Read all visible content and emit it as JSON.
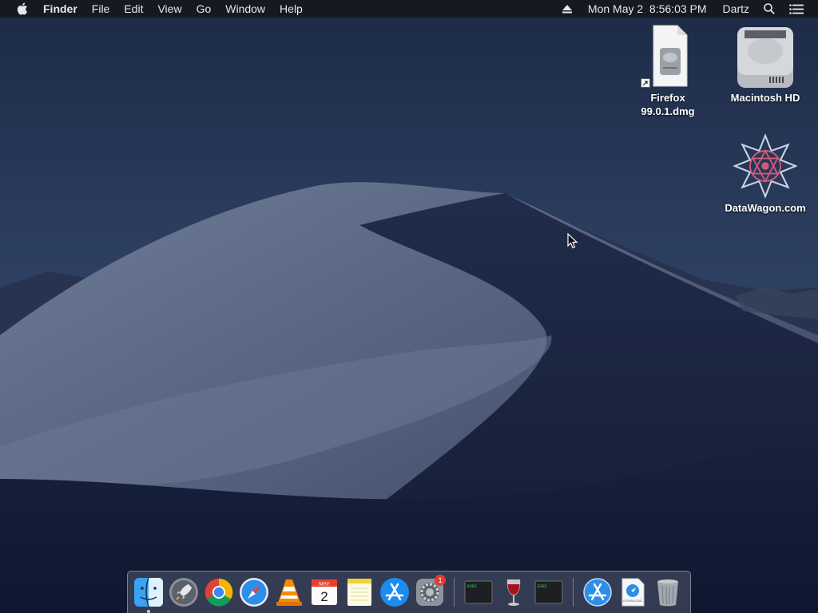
{
  "menubar": {
    "apple_icon": "apple-logo-icon",
    "app_name": "Finder",
    "menus": [
      "File",
      "Edit",
      "View",
      "Go",
      "Window",
      "Help"
    ],
    "eject_icon": "eject-icon",
    "clock": "Mon May 2  8:56:03 PM",
    "user": "Dartz",
    "search_icon": "spotlight-search-icon",
    "notification_icon": "notification-center-icon"
  },
  "desktop": {
    "icons": [
      {
        "label": "Firefox\n99.0.1.dmg",
        "icon": "disk-image-file-icon"
      },
      {
        "label": "Macintosh HD",
        "icon": "hard-drive-icon"
      },
      {
        "label": "DataWagon.com",
        "icon": "datawagon-logo-icon"
      }
    ]
  },
  "dock": {
    "items": [
      {
        "name": "Finder",
        "icon": "finder-icon",
        "running": true
      },
      {
        "name": "Launchpad",
        "icon": "launchpad-icon"
      },
      {
        "name": "Google Chrome",
        "icon": "chrome-icon"
      },
      {
        "name": "Safari",
        "icon": "safari-icon"
      },
      {
        "name": "VLC",
        "icon": "vlc-icon"
      },
      {
        "name": "Calendar",
        "icon": "calendar-icon",
        "month": "MAY",
        "day": "2"
      },
      {
        "name": "Notes",
        "icon": "notes-icon"
      },
      {
        "name": "App Store",
        "icon": "app-store-icon"
      },
      {
        "name": "System Preferences",
        "icon": "system-preferences-icon",
        "badge": "1"
      },
      {
        "name": "Terminal",
        "icon": "terminal-exec-icon",
        "text": "EXEC"
      },
      {
        "name": "Wine",
        "icon": "wine-icon"
      },
      {
        "name": "Terminal",
        "icon": "terminal-exec-icon",
        "text": "EXEC"
      },
      {
        "name": "Applications",
        "icon": "applications-folder-icon"
      },
      {
        "name": "Downloads",
        "icon": "downloads-stack-icon",
        "text": "DOWNLOAD"
      },
      {
        "name": "Trash",
        "icon": "trash-icon"
      }
    ]
  }
}
